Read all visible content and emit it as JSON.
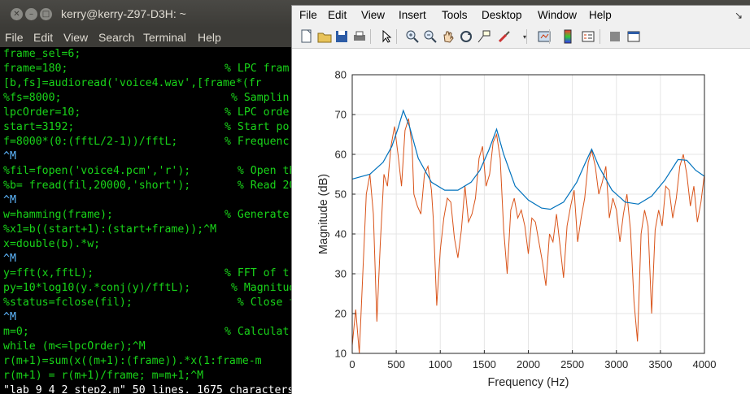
{
  "terminal": {
    "title": "kerry@kerry-Z97-D3H: ~",
    "menu": [
      "File",
      "Edit",
      "View",
      "Search",
      "Terminal",
      "Help"
    ],
    "lines": [
      {
        "code": "frame_sel=6;",
        "comment": ""
      },
      {
        "code": "frame=180;",
        "comment": "% LPC fram"
      },
      {
        "code": "[b,fs]=audioread('voice4.wav',[frame*(fr",
        "comment": ""
      },
      {
        "code": "%fs=8000;",
        "comment": " % Samplin"
      },
      {
        "code": "lpcOrder=10;",
        "comment": "% LPC orde"
      },
      {
        "code": "start=3192;",
        "comment": "% Start po"
      },
      {
        "code": "f=8000*(0:(fftL/2-1))/fftL;",
        "comment": "% Frequenc"
      },
      {
        "code": "^M",
        "comment": ""
      },
      {
        "code": "%fil=fopen('voice4.pcm','r');",
        "comment": "  % Open th"
      },
      {
        "code": "%b= fread(fil,20000,'short');",
        "comment": "  % Read 20"
      },
      {
        "code": "^M",
        "comment": ""
      },
      {
        "code": "w=hamming(frame);",
        "comment": "% Generate"
      },
      {
        "code": "%x1=b((start+1):(start+frame));^M",
        "comment": ""
      },
      {
        "code": "x=double(b).*w;",
        "comment": "             % W"
      },
      {
        "code": "^M",
        "comment": ""
      },
      {
        "code": "y=fft(x,fftL);",
        "comment": "% FFT of t"
      },
      {
        "code": "py=10*log10(y.*conj(y)/fftL);",
        "comment": " % Magnitud"
      },
      {
        "code": "%status=fclose(fil);",
        "comment": "  % Close t"
      },
      {
        "code": "^M",
        "comment": ""
      },
      {
        "code": "m=0;",
        "comment": "% Calculat"
      },
      {
        "code": "while (m<=lpcOrder);^M",
        "comment": ""
      },
      {
        "code": "r(m+1)=sum(x((m+1):(frame)).*x(1:frame-m",
        "comment": ""
      },
      {
        "code": "r(m+1) = r(m+1)/frame; m=m+1;^M",
        "comment": ""
      },
      {
        "code": "\"lab_9_4_2_step2.m\" 50 lines, 1675 characters written",
        "comment": ""
      }
    ]
  },
  "figure": {
    "menu": [
      "File",
      "Edit",
      "View",
      "Insert",
      "Tools",
      "Desktop",
      "Window",
      "Help"
    ],
    "toolbar_icons": [
      "new-figure-icon",
      "open-file-icon",
      "save-icon",
      "print-icon",
      "edit-plot-arrow-icon",
      "zoom-in-icon",
      "zoom-out-icon",
      "pan-hand-icon",
      "rotate-3d-icon",
      "data-cursor-icon",
      "brush-icon",
      "link-plot-icon",
      "colorbar-icon",
      "legend-icon",
      "hide-plot-tools-icon",
      "show-plot-tools-icon"
    ],
    "colors": {
      "envelope": "#0072bd",
      "spectrum": "#d95319",
      "grid": "#e5e5e5",
      "axes": "#262626"
    }
  },
  "chart_data": {
    "type": "line",
    "xlabel": "Frequency (Hz)",
    "ylabel": "Magnitude (dB)",
    "xlim": [
      0,
      4000
    ],
    "ylim": [
      10,
      80
    ],
    "xticks": [
      0,
      500,
      1000,
      1500,
      2000,
      2500,
      3000,
      3500,
      4000
    ],
    "yticks": [
      10,
      20,
      30,
      40,
      50,
      60,
      70,
      80
    ],
    "grid": true,
    "series": [
      {
        "color": "#0072bd",
        "x": [
          0,
          200,
          350,
          450,
          520,
          580,
          650,
          750,
          900,
          1050,
          1200,
          1350,
          1450,
          1550,
          1640,
          1720,
          1850,
          2000,
          2150,
          2250,
          2400,
          2550,
          2650,
          2720,
          2800,
          2950,
          3100,
          3250,
          3400,
          3550,
          3700,
          3800,
          3900,
          4000
        ],
        "y": [
          53.8,
          55,
          58,
          62,
          66.5,
          71,
          67,
          59,
          53,
          51,
          51,
          53,
          56,
          61,
          66.3,
          60,
          52,
          48.5,
          46.5,
          46.2,
          48,
          53,
          58,
          61.3,
          57,
          51,
          48,
          47.5,
          49.5,
          53.5,
          58.7,
          58.5,
          56,
          54.5
        ]
      },
      {
        "color": "#d95319",
        "x": [
          0,
          40,
          80,
          120,
          160,
          200,
          240,
          280,
          320,
          360,
          400,
          440,
          480,
          520,
          560,
          600,
          640,
          680,
          700,
          740,
          780,
          820,
          860,
          900,
          920,
          960,
          1000,
          1040,
          1080,
          1120,
          1160,
          1200,
          1240,
          1280,
          1320,
          1360,
          1400,
          1440,
          1480,
          1520,
          1560,
          1600,
          1640,
          1680,
          1720,
          1760,
          1800,
          1840,
          1880,
          1920,
          1960,
          2000,
          2040,
          2080,
          2120,
          2160,
          2200,
          2240,
          2280,
          2320,
          2360,
          2400,
          2440,
          2480,
          2520,
          2560,
          2600,
          2640,
          2680,
          2720,
          2760,
          2800,
          2840,
          2880,
          2920,
          2960,
          3000,
          3040,
          3080,
          3120,
          3160,
          3200,
          3240,
          3280,
          3320,
          3360,
          3400,
          3440,
          3480,
          3520,
          3560,
          3600,
          3640,
          3680,
          3720,
          3760,
          3800,
          3840,
          3880,
          3920,
          3960,
          4000
        ],
        "y": [
          12,
          21,
          9,
          30,
          50,
          55,
          45,
          18,
          38,
          55,
          52,
          62,
          67,
          60,
          52,
          66,
          69,
          62,
          50,
          47,
          45,
          55,
          57,
          51,
          44,
          22,
          36,
          44,
          49,
          48,
          39,
          34,
          41,
          52,
          43,
          45,
          49,
          59,
          62,
          52,
          55,
          63,
          65,
          59,
          41,
          30,
          46,
          49,
          44,
          46,
          42,
          35,
          44,
          43,
          38,
          33,
          27,
          40,
          38,
          45,
          37,
          29,
          42,
          47,
          51,
          38,
          44,
          49,
          58,
          61,
          57,
          50,
          53,
          57,
          44,
          49,
          46,
          38,
          45,
          50,
          41,
          23,
          13,
          40,
          46,
          42,
          20,
          41,
          46,
          42,
          52,
          51,
          44,
          49,
          57,
          60,
          55,
          47,
          52,
          43,
          48,
          55
        ]
      }
    ]
  }
}
